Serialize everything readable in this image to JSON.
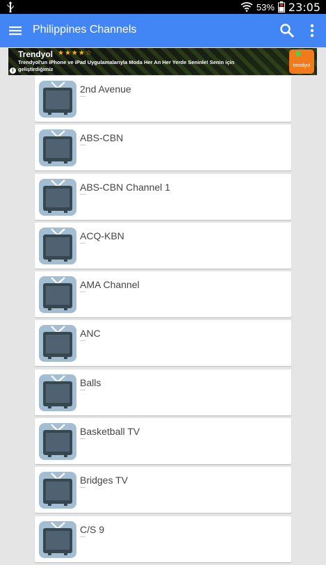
{
  "status_bar": {
    "battery": "53%",
    "time": "23:05"
  },
  "app_bar": {
    "title": "Philippines Channels"
  },
  "ad": {
    "brand": "Trendyol",
    "stars": "★★★★☆",
    "description": "Trendyol'un iPhone ve iPad Uygulamalarıyla Moda Her An Her Yerde Seninle! Senin için geliştirdiğimiz",
    "logo_text": "trendyol",
    "info_symbol": "i"
  },
  "channels": [
    {
      "name": "2nd Avenue"
    },
    {
      "name": "ABS-CBN"
    },
    {
      "name": "ABS-CBN Channel 1"
    },
    {
      "name": "ACQ-KBN"
    },
    {
      "name": "AMA Channel"
    },
    {
      "name": "ANC"
    },
    {
      "name": "Balls"
    },
    {
      "name": "Basketball TV"
    },
    {
      "name": "Bridges TV"
    },
    {
      "name": "C/S 9"
    }
  ],
  "colors": {
    "app_bar": "#4285f4",
    "icon_bg": "#a3bdd2",
    "background": "#e5e5e5"
  },
  "icons": {
    "channel": "tv-icon",
    "menu": "menu-icon",
    "search": "search-icon",
    "more": "more-vert-icon"
  }
}
